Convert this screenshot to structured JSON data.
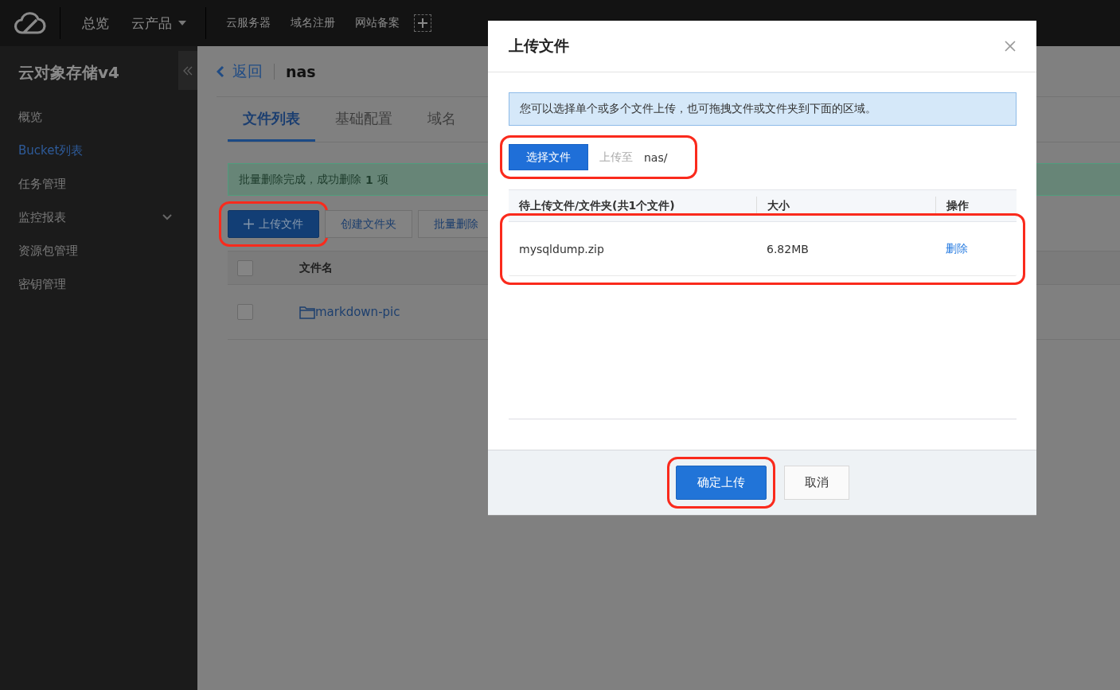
{
  "top_nav": {
    "items": [
      {
        "label": "总览",
        "dropdown": false
      },
      {
        "label": "云产品",
        "dropdown": true
      }
    ],
    "shortcuts": [
      "云服务器",
      "域名注册",
      "网站备案"
    ]
  },
  "sidebar": {
    "title": "云对象存储v4",
    "items": [
      {
        "label": "概览",
        "selected": false,
        "has_submenu": false
      },
      {
        "label": "Bucket列表",
        "selected": true,
        "has_submenu": false
      },
      {
        "label": "任务管理",
        "selected": false,
        "has_submenu": false
      },
      {
        "label": "监控报表",
        "selected": false,
        "has_submenu": true
      },
      {
        "label": "资源包管理",
        "selected": false,
        "has_submenu": false
      },
      {
        "label": "密钥管理",
        "selected": false,
        "has_submenu": false
      }
    ]
  },
  "page": {
    "back": "返回",
    "bucket": "nas",
    "tabs": [
      {
        "label": "文件列表",
        "selected": true
      },
      {
        "label": "基础配置",
        "selected": false
      },
      {
        "label": "域名",
        "selected": false
      }
    ],
    "alert": "批量删除完成，成功删除 **1** 项",
    "toolbar": [
      {
        "label": "上传文件",
        "kind": "primary",
        "highlighted": true
      },
      {
        "label": "创建文件夹",
        "kind": "default",
        "highlighted": false
      },
      {
        "label": "批量删除",
        "kind": "default",
        "highlighted": false
      }
    ],
    "table": {
      "columns": [
        "文件名"
      ],
      "all_checked": false,
      "rows": [
        {
          "name": "markdown-pic",
          "kind": "folder",
          "checked": false
        }
      ]
    }
  },
  "dialog": {
    "title": "上传文件",
    "notice": "您可以选择单个或多个文件上传，也可拖拽文件或文件夹到下面的区域。",
    "select_button": "选择文件",
    "target_label": "上传至",
    "target_path": "nas/",
    "select_highlighted": true,
    "columns": [
      "待上传文件/文件夹(共1个文件)",
      "大小",
      "操作"
    ],
    "files": [
      {
        "name": "mysqldump.zip",
        "size": "6.82MB",
        "action": "删除",
        "highlighted": true
      }
    ],
    "buttons": [
      {
        "label": "确定上传",
        "kind": "primary",
        "highlighted": true
      },
      {
        "label": "取消",
        "kind": "default",
        "highlighted": false
      }
    ]
  }
}
